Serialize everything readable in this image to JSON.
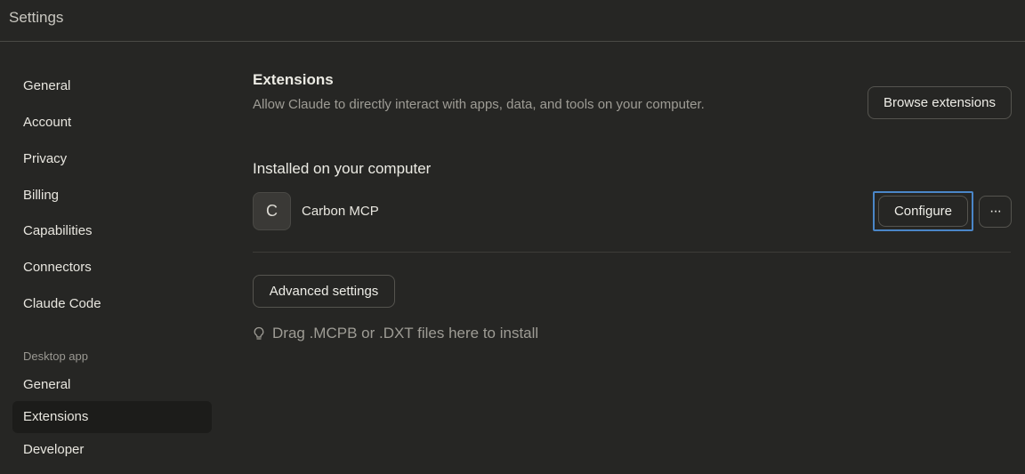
{
  "app": {
    "title": "Settings"
  },
  "sidebar": {
    "items": [
      {
        "label": "General"
      },
      {
        "label": "Account"
      },
      {
        "label": "Privacy"
      },
      {
        "label": "Billing"
      },
      {
        "label": "Capabilities"
      },
      {
        "label": "Connectors"
      },
      {
        "label": "Claude Code"
      }
    ],
    "section_label": "Desktop app",
    "desktop_items": [
      {
        "label": "General"
      },
      {
        "label": "Extensions",
        "active": true
      },
      {
        "label": "Developer"
      }
    ]
  },
  "main": {
    "title": "Extensions",
    "description": "Allow Claude to directly interact with apps, data, and tools on your computer.",
    "browse_button": "Browse extensions",
    "installed_title": "Installed on your computer",
    "extensions": [
      {
        "avatar_letter": "C",
        "name": "Carbon MCP",
        "configure_label": "Configure",
        "more_label": "···"
      }
    ],
    "advanced_button": "Advanced settings",
    "drop_hint": "Drag .MCPB or .DXT files here to install",
    "drop_icon": "lightbulb-icon"
  },
  "colors": {
    "background": "#262624",
    "focus_ring": "#4a86c8",
    "active_nav": "#1c1c1a"
  }
}
